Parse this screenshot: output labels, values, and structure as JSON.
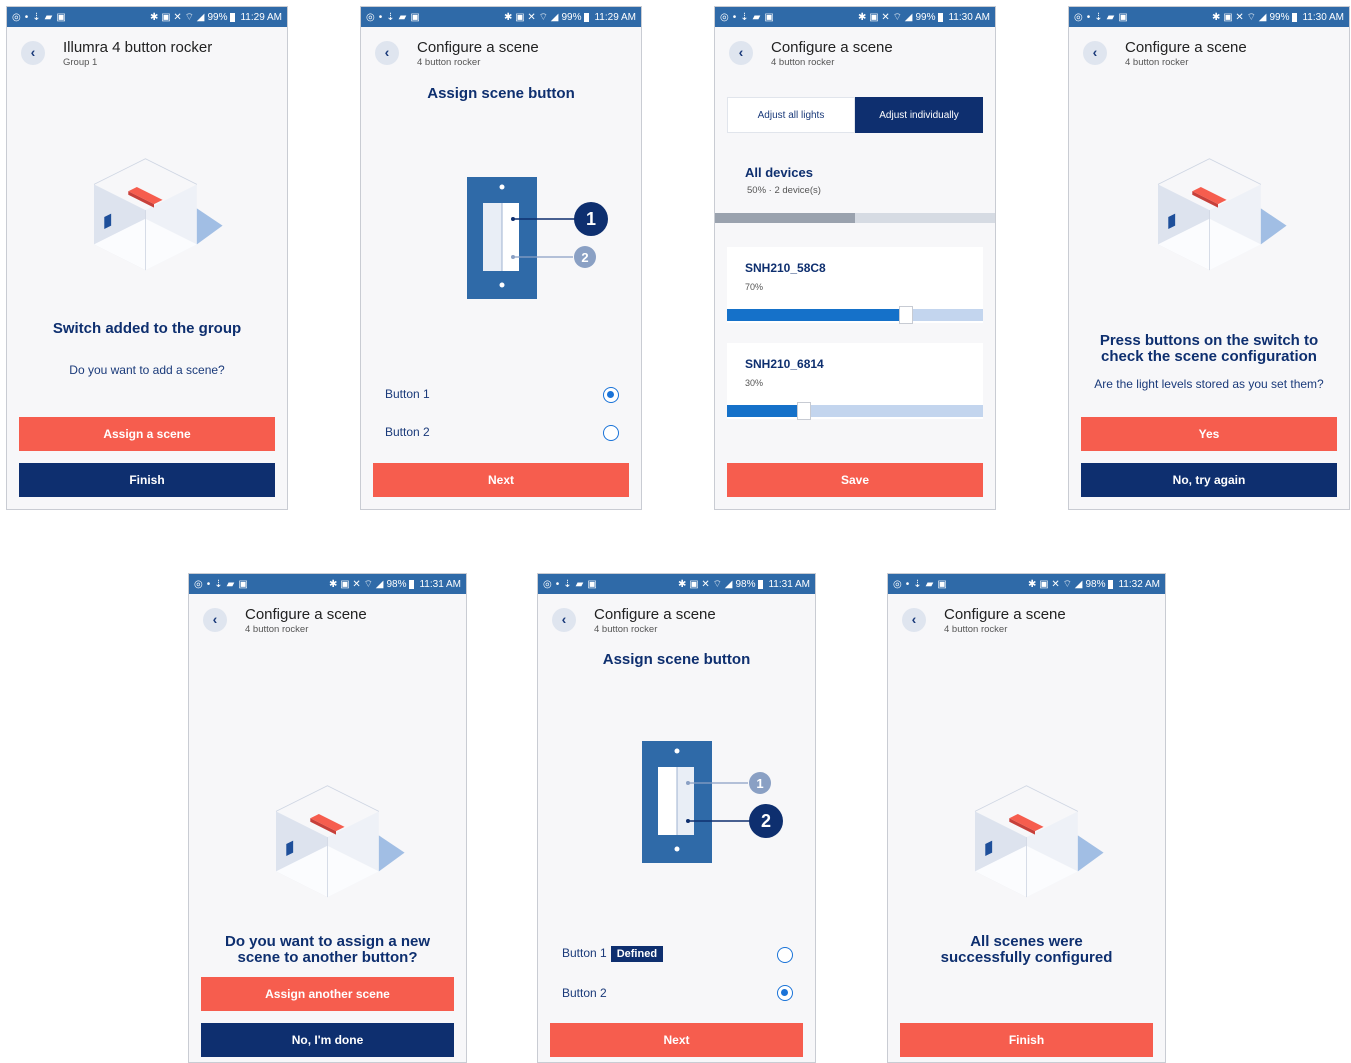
{
  "screens": [
    {
      "status": {
        "time": "11:29 AM",
        "battery": "99%"
      },
      "header": {
        "title": "Illumra 4 button rocker",
        "subtitle": "Group 1"
      },
      "message": "Switch added to the group",
      "question": "Do you want to add a scene?",
      "primary_button": "Assign a scene",
      "secondary_button": "Finish"
    },
    {
      "status": {
        "time": "11:29 AM",
        "battery": "99%"
      },
      "header": {
        "title": "Configure a scene",
        "subtitle": "4 button rocker"
      },
      "heading": "Assign scene button",
      "callout_1": "1",
      "callout_2": "2",
      "options": [
        {
          "label": "Button 1",
          "selected": true
        },
        {
          "label": "Button 2",
          "selected": false
        }
      ],
      "primary_button": "Next"
    },
    {
      "status": {
        "time": "11:30 AM",
        "battery": "99%"
      },
      "header": {
        "title": "Configure a scene",
        "subtitle": "4 button rocker"
      },
      "tabs": [
        {
          "label": "Adjust all lights",
          "active": false
        },
        {
          "label": "Adjust individually",
          "active": true
        }
      ],
      "all_devices": {
        "title": "All devices",
        "summary": "50% · 2 device(s)",
        "level": 0.5
      },
      "devices": [
        {
          "name": "SNH210_58C8",
          "percent": "70%",
          "level": 0.7
        },
        {
          "name": "SNH210_6814",
          "percent": "30%",
          "level": 0.3
        }
      ],
      "primary_button": "Save"
    },
    {
      "status": {
        "time": "11:30 AM",
        "battery": "99%"
      },
      "header": {
        "title": "Configure a scene",
        "subtitle": "4 button rocker"
      },
      "message_line1": "Press buttons on the switch to",
      "message_line2": "check the scene configuration",
      "question": "Are the light levels stored as you set them?",
      "primary_button": "Yes",
      "secondary_button": "No, try again"
    },
    {
      "status": {
        "time": "11:31 AM",
        "battery": "98%"
      },
      "header": {
        "title": "Configure a scene",
        "subtitle": "4 button rocker"
      },
      "message_line1": "Do you want to assign a new",
      "message_line2": "scene to another button?",
      "primary_button": "Assign another scene",
      "secondary_button": "No, I'm done"
    },
    {
      "status": {
        "time": "11:31 AM",
        "battery": "98%"
      },
      "header": {
        "title": "Configure a scene",
        "subtitle": "4 button rocker"
      },
      "heading": "Assign scene button",
      "callout_1": "1",
      "callout_2": "2",
      "options": [
        {
          "label": "Button 1",
          "badge": "Defined",
          "selected": false
        },
        {
          "label": "Button 2",
          "selected": true
        }
      ],
      "primary_button": "Next"
    },
    {
      "status": {
        "time": "11:32 AM",
        "battery": "98%"
      },
      "header": {
        "title": "Configure a scene",
        "subtitle": "4 button rocker"
      },
      "message_line1": "All scenes were",
      "message_line2": "successfully configured",
      "primary_button": "Finish"
    }
  ],
  "colors": {
    "status_bar": "#2f6aa8",
    "coral": "#f65d4e",
    "navy": "#0e2f6f",
    "accent_blue": "#1a73d8",
    "slider_fill": "#1571c9",
    "switch_plate": "#2f6aa8"
  },
  "icons": [
    "back-chevron-icon",
    "room-illustration",
    "rocker-switch-diagram",
    "radio-selected-icon",
    "radio-empty-icon"
  ]
}
